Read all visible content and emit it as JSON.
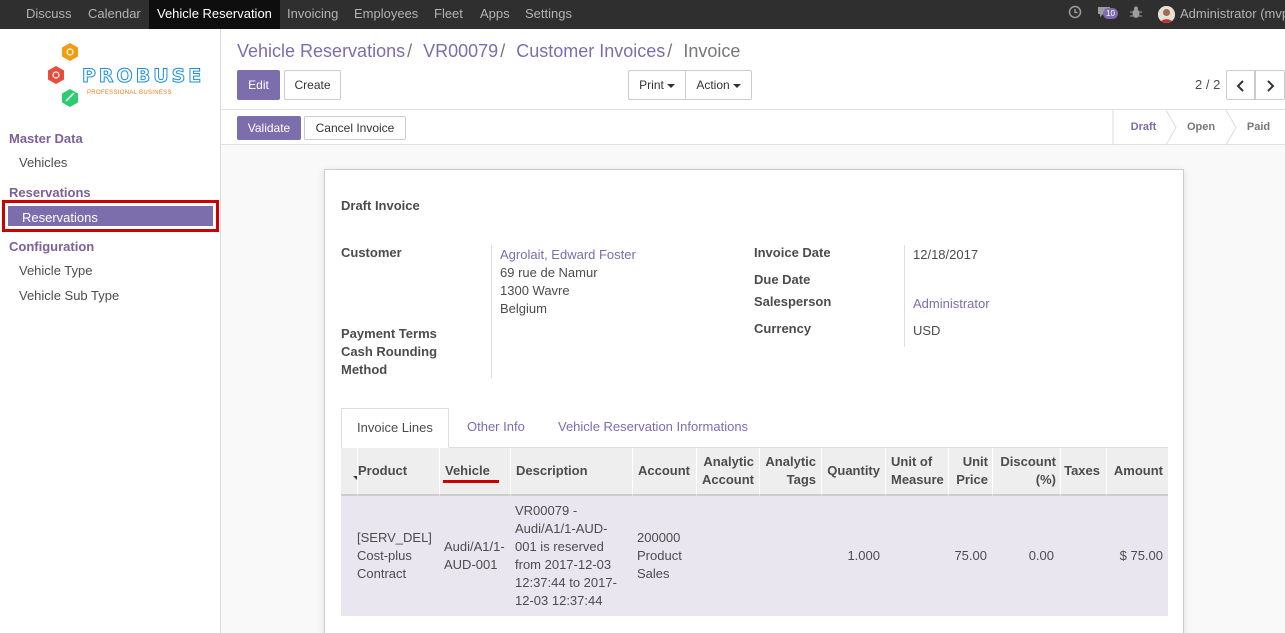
{
  "topbar": {
    "menus": [
      "Discuss",
      "Calendar",
      "Vehicle Reservation",
      "Invoicing",
      "Employees",
      "Fleet",
      "Apps",
      "Settings"
    ],
    "active_menu": "Vehicle Reservation",
    "messages_count": "10",
    "user": "Administrator (mvp"
  },
  "sidebar": {
    "logo_text": "PROBUSE",
    "logo_tagline": "PROFESSIONAL BUSINESS",
    "sections": [
      {
        "heading": "Master Data",
        "items": [
          "Vehicles"
        ]
      },
      {
        "heading": "Reservations",
        "items": [
          "Reservations"
        ]
      },
      {
        "heading": "Configuration",
        "items": [
          "Vehicle Type",
          "Vehicle Sub Type"
        ]
      }
    ]
  },
  "breadcrumb": [
    "Vehicle Reservations",
    "VR00079",
    "Customer Invoices",
    "Invoice"
  ],
  "buttons": {
    "edit": "Edit",
    "create": "Create",
    "print": "Print",
    "action": "Action",
    "validate": "Validate",
    "cancel_invoice": "Cancel Invoice"
  },
  "pager": "2 / 2",
  "stages": [
    "Draft",
    "Open",
    "Paid"
  ],
  "current_stage": "Draft",
  "form": {
    "title": "Draft Invoice",
    "customer_label": "Customer",
    "customer_name": "Agrolait, Edward Foster",
    "customer_address": [
      "69 rue de Namur",
      "1300 Wavre",
      "Belgium"
    ],
    "payment_terms_label": "Payment Terms",
    "cash_rounding_label": [
      "Cash Rounding",
      "Method"
    ],
    "invoice_date_label": "Invoice Date",
    "invoice_date": "12/18/2017",
    "due_date_label": "Due Date",
    "salesperson_label": "Salesperson",
    "salesperson": "Administrator",
    "currency_label": "Currency",
    "currency": "USD"
  },
  "tabs": [
    "Invoice Lines",
    "Other Info",
    "Vehicle Reservation Informations"
  ],
  "table": {
    "headers": [
      "Product",
      "Vehicle",
      "Description",
      "Account",
      "Analytic Account",
      "Analytic Tags",
      "Quantity",
      "Unit of Measure",
      "Unit Price",
      "Discount (%)",
      "Taxes",
      "Amount"
    ],
    "rows": [
      {
        "product": "[SERV_DEL] Cost-plus Contract",
        "vehicle": "Audi/A1/1-AUD-001",
        "description": "VR00079 - Audi/A1/1-AUD-001 is reserved from 2017-12-03 12:37:44 to 2017-12-03 12:37:44",
        "account": "200000 Product Sales",
        "analytic_account": "",
        "analytic_tags": "",
        "quantity": "1.000",
        "uom": "",
        "unit_price": "75.00",
        "discount": "0.00",
        "taxes": "",
        "amount": "$ 75.00"
      }
    ]
  },
  "colors": {
    "accent": "#7c6dad",
    "topbar": "#2f2f2f",
    "highlight_border": "#cc0000"
  }
}
